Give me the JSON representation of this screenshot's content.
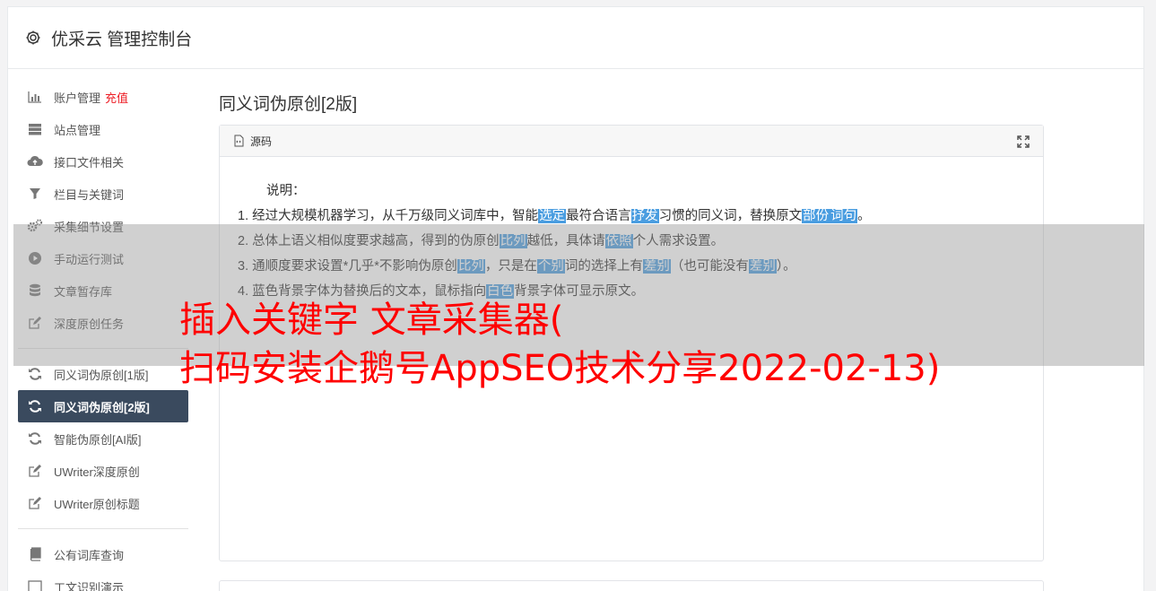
{
  "header": {
    "title": "优采云 管理控制台"
  },
  "sidebar": {
    "group1": [
      {
        "label": "账户管理",
        "badge": "充值",
        "icon": "bar-chart-icon"
      },
      {
        "label": "站点管理",
        "icon": "server-icon"
      },
      {
        "label": "接口文件相关",
        "icon": "cloud-upload-icon"
      },
      {
        "label": "栏目与关键词",
        "icon": "filter-icon"
      },
      {
        "label": "采集细节设置",
        "icon": "cogs-icon"
      },
      {
        "label": "手动运行测试",
        "icon": "play-circle-icon"
      },
      {
        "label": "文章暂存库",
        "icon": "database-icon"
      },
      {
        "label": "深度原创任务",
        "icon": "edit-icon"
      }
    ],
    "group2": [
      {
        "label": "同义词伪原创[1版]",
        "icon": "refresh-icon"
      },
      {
        "label": "同义词伪原创[2版]",
        "icon": "refresh-icon",
        "active": true
      },
      {
        "label": "智能伪原创[AI版]",
        "icon": "refresh-icon"
      },
      {
        "label": "UWriter深度原创",
        "icon": "edit-icon"
      },
      {
        "label": "UWriter原创标题",
        "icon": "edit-icon"
      }
    ],
    "group3": [
      {
        "label": "公有词库查询",
        "icon": "book-icon"
      },
      {
        "label": "工文识别演示",
        "icon": "text-icon"
      }
    ]
  },
  "main": {
    "page_title": "同义词伪原创[2版]",
    "panel_title": "源码",
    "intro": "说明：",
    "lines": [
      [
        {
          "t": "1. 经过大规模机器学习，从千万级同义词库中，智能"
        },
        {
          "t": "选定",
          "h": true
        },
        {
          "t": "最符合语言"
        },
        {
          "t": "抒发",
          "h": true
        },
        {
          "t": "习惯的同义词，替换原文"
        },
        {
          "t": "部份",
          "h": true
        },
        {
          "t": "词句",
          "h": true
        },
        {
          "t": "。"
        }
      ],
      [
        {
          "t": "2. 总体上语义相似度要求越高，得到的伪原创"
        },
        {
          "t": "比列",
          "h": true
        },
        {
          "t": "越低，具体请"
        },
        {
          "t": "依照",
          "h": true
        },
        {
          "t": "个人需求设置。"
        }
      ],
      [
        {
          "t": "3. 通顺度要求设置*几乎*不影响伪原创"
        },
        {
          "t": "比列",
          "h": true
        },
        {
          "t": "，只是在"
        },
        {
          "t": "个别",
          "h": true
        },
        {
          "t": "词的选择上有"
        },
        {
          "t": "差别",
          "h": true
        },
        {
          "t": "（也可能没有"
        },
        {
          "t": "差别",
          "h": true
        },
        {
          "t": "）。"
        }
      ],
      [
        {
          "t": "4. 蓝色背景字体为替换后的文本，鼠标指向"
        },
        {
          "t": "白色",
          "h": true
        },
        {
          "t": "背景字体可显示原文。"
        }
      ]
    ]
  },
  "overlay": {
    "line1": "插入关键字 文章采集器(",
    "line2": "扫码安装企鹅号AppSEO技术分享2022-02-13)"
  },
  "colors": {
    "active_nav": "#3a4a5e",
    "highlight": "#4a9de0",
    "overlay_text": "#ff0000",
    "recharge": "#ed1c24"
  }
}
